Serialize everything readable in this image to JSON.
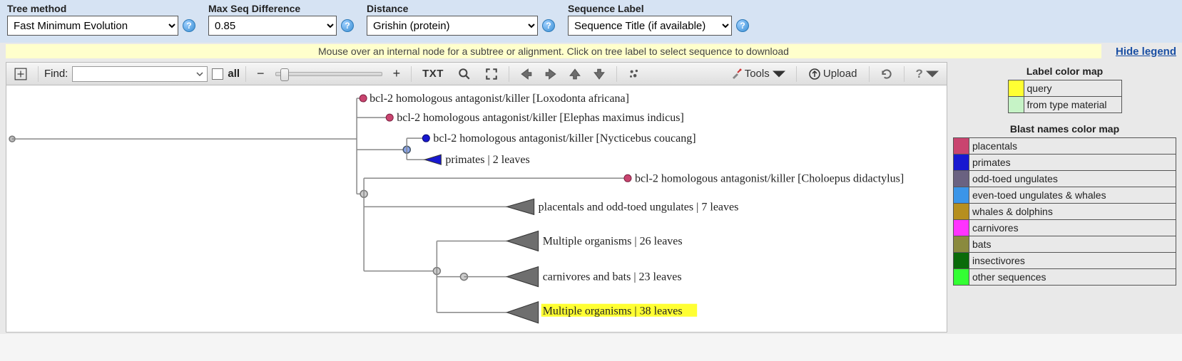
{
  "controls": {
    "tree_method": {
      "label": "Tree method",
      "value": "Fast Minimum Evolution"
    },
    "max_seq_diff": {
      "label": "Max Seq Difference",
      "value": "0.85"
    },
    "distance": {
      "label": "Distance",
      "value": "Grishin (protein)"
    },
    "sequence_label": {
      "label": "Sequence Label",
      "value": "Sequence Title (if available)"
    }
  },
  "hint": "Mouse over an internal node for a subtree or alignment. Click on tree label to select sequence to download",
  "hide_legend": "Hide legend",
  "toolbar": {
    "find_label": "Find:",
    "find_value": "",
    "all_label": "all",
    "txt_label": "TXT",
    "tools_label": "Tools",
    "upload_label": "Upload"
  },
  "tree": {
    "leaves": [
      {
        "name": "leaf-loxodonta",
        "label": "bcl-2 homologous antagonist/killer [Loxodonta africana]",
        "color": "#c9446f",
        "kind": "dot"
      },
      {
        "name": "leaf-elephas",
        "label": "bcl-2 homologous antagonist/killer [Elephas maximus indicus]",
        "color": "#c9446f",
        "kind": "dot"
      },
      {
        "name": "leaf-nycticebus",
        "label": "bcl-2 homologous antagonist/killer [Nycticebus coucang]",
        "color": "#1818d0",
        "kind": "dot"
      },
      {
        "name": "leaf-primates",
        "label": "primates | 2 leaves",
        "color": "#1818d0",
        "kind": "tri"
      },
      {
        "name": "leaf-choloepus",
        "label": "bcl-2 homologous antagonist/killer [Choloepus didactylus]",
        "color": "#c9446f",
        "kind": "dot"
      },
      {
        "name": "leaf-placentals-odd",
        "label": "placentals and odd-toed ungulates | 7 leaves",
        "color": "#6e6e6e",
        "kind": "tri"
      },
      {
        "name": "leaf-multi26",
        "label": "Multiple organisms | 26 leaves",
        "color": "#6e6e6e",
        "kind": "tri"
      },
      {
        "name": "leaf-carnivores-bats",
        "label": "carnivores and bats | 23 leaves",
        "color": "#6e6e6e",
        "kind": "tri"
      },
      {
        "name": "leaf-multi38",
        "label": "Multiple organisms | 38 leaves",
        "color": "#6e6e6e",
        "kind": "tri",
        "highlight": true
      }
    ]
  },
  "legend": {
    "label_map_title": "Label color map",
    "label_map": [
      {
        "color": "#ffff33",
        "name": "query"
      },
      {
        "color": "#c6f3c6",
        "name": "from type material"
      }
    ],
    "blast_map_title": "Blast names color map",
    "blast_map": [
      {
        "color": "#c9446f",
        "name": "placentals"
      },
      {
        "color": "#1818d0",
        "name": "primates"
      },
      {
        "color": "#6a6281",
        "name": "odd-toed ungulates"
      },
      {
        "color": "#3b95e8",
        "name": "even-toed ungulates & whales"
      },
      {
        "color": "#b68f1f",
        "name": "whales & dolphins"
      },
      {
        "color": "#ff33ff",
        "name": "carnivores"
      },
      {
        "color": "#8a8a3e",
        "name": "bats"
      },
      {
        "color": "#0a6b0a",
        "name": "insectivores"
      },
      {
        "color": "#33ff33",
        "name": "other sequences"
      }
    ]
  }
}
